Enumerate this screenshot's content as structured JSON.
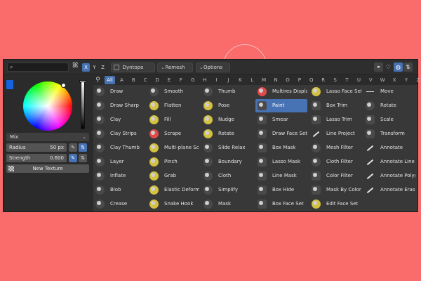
{
  "toolbar": {
    "search_value": "",
    "axes": [
      {
        "label": "X",
        "active": true
      },
      {
        "label": "Y",
        "active": false
      },
      {
        "label": "Z",
        "active": false
      }
    ],
    "dyntopo_label": "Dyntopo",
    "remesh_label": "Remesh",
    "options_label": "Options",
    "accent_color": "#4772b3"
  },
  "brush_panel": {
    "color": "#1463e0",
    "blend_mode": "Mix",
    "radius_label": "Radius",
    "radius_value": "50 px",
    "strength_label": "Strength",
    "strength_value": "0.600",
    "new_texture_label": "New Texture"
  },
  "alphabet": {
    "active": "All",
    "letters": [
      "All",
      "A",
      "B",
      "C",
      "D",
      "E",
      "F",
      "G",
      "H",
      "I",
      "J",
      "K",
      "L",
      "M",
      "N",
      "O",
      "P",
      "Q",
      "R",
      "S",
      "T",
      "U",
      "V",
      "W",
      "X",
      "Y",
      "Z"
    ]
  },
  "tools": {
    "selected": "Paint",
    "columns": [
      [
        "Draw",
        "Draw Sharp",
        "Clay",
        "Clay Strips",
        "Clay Thumb",
        "Layer",
        "Inflate",
        "Blob",
        "Crease"
      ],
      [
        "Smooth",
        "Flatten",
        "Fill",
        "Scrape",
        "Multi-plane Sc...",
        "Pinch",
        "Grab",
        "Elastic Deform",
        "Snake Hook"
      ],
      [
        "Thumb",
        "Pose",
        "Nudge",
        "Rotate",
        "Slide Relax",
        "Boundary",
        "Cloth",
        "Simplify",
        "Mask"
      ],
      [
        "Multires Displacem...",
        "Paint",
        "Smear",
        "Draw Face Sets",
        "Box Mask",
        "Lasso Mask",
        "Line Mask",
        "Box Hide",
        "Box Face Set"
      ],
      [
        "Lasso Face Set",
        "Box Trim",
        "Lasso Trim",
        "Line Project",
        "Mesh Filter",
        "Cloth Filter",
        "Color Filter",
        "Mask By Color",
        "Edit Face Set"
      ],
      [
        "Move",
        "Rotate",
        "Scale",
        "Transform",
        "Annotate",
        "Annotate Line",
        "Annotate Polygon",
        "Annotate Eraser"
      ]
    ]
  }
}
